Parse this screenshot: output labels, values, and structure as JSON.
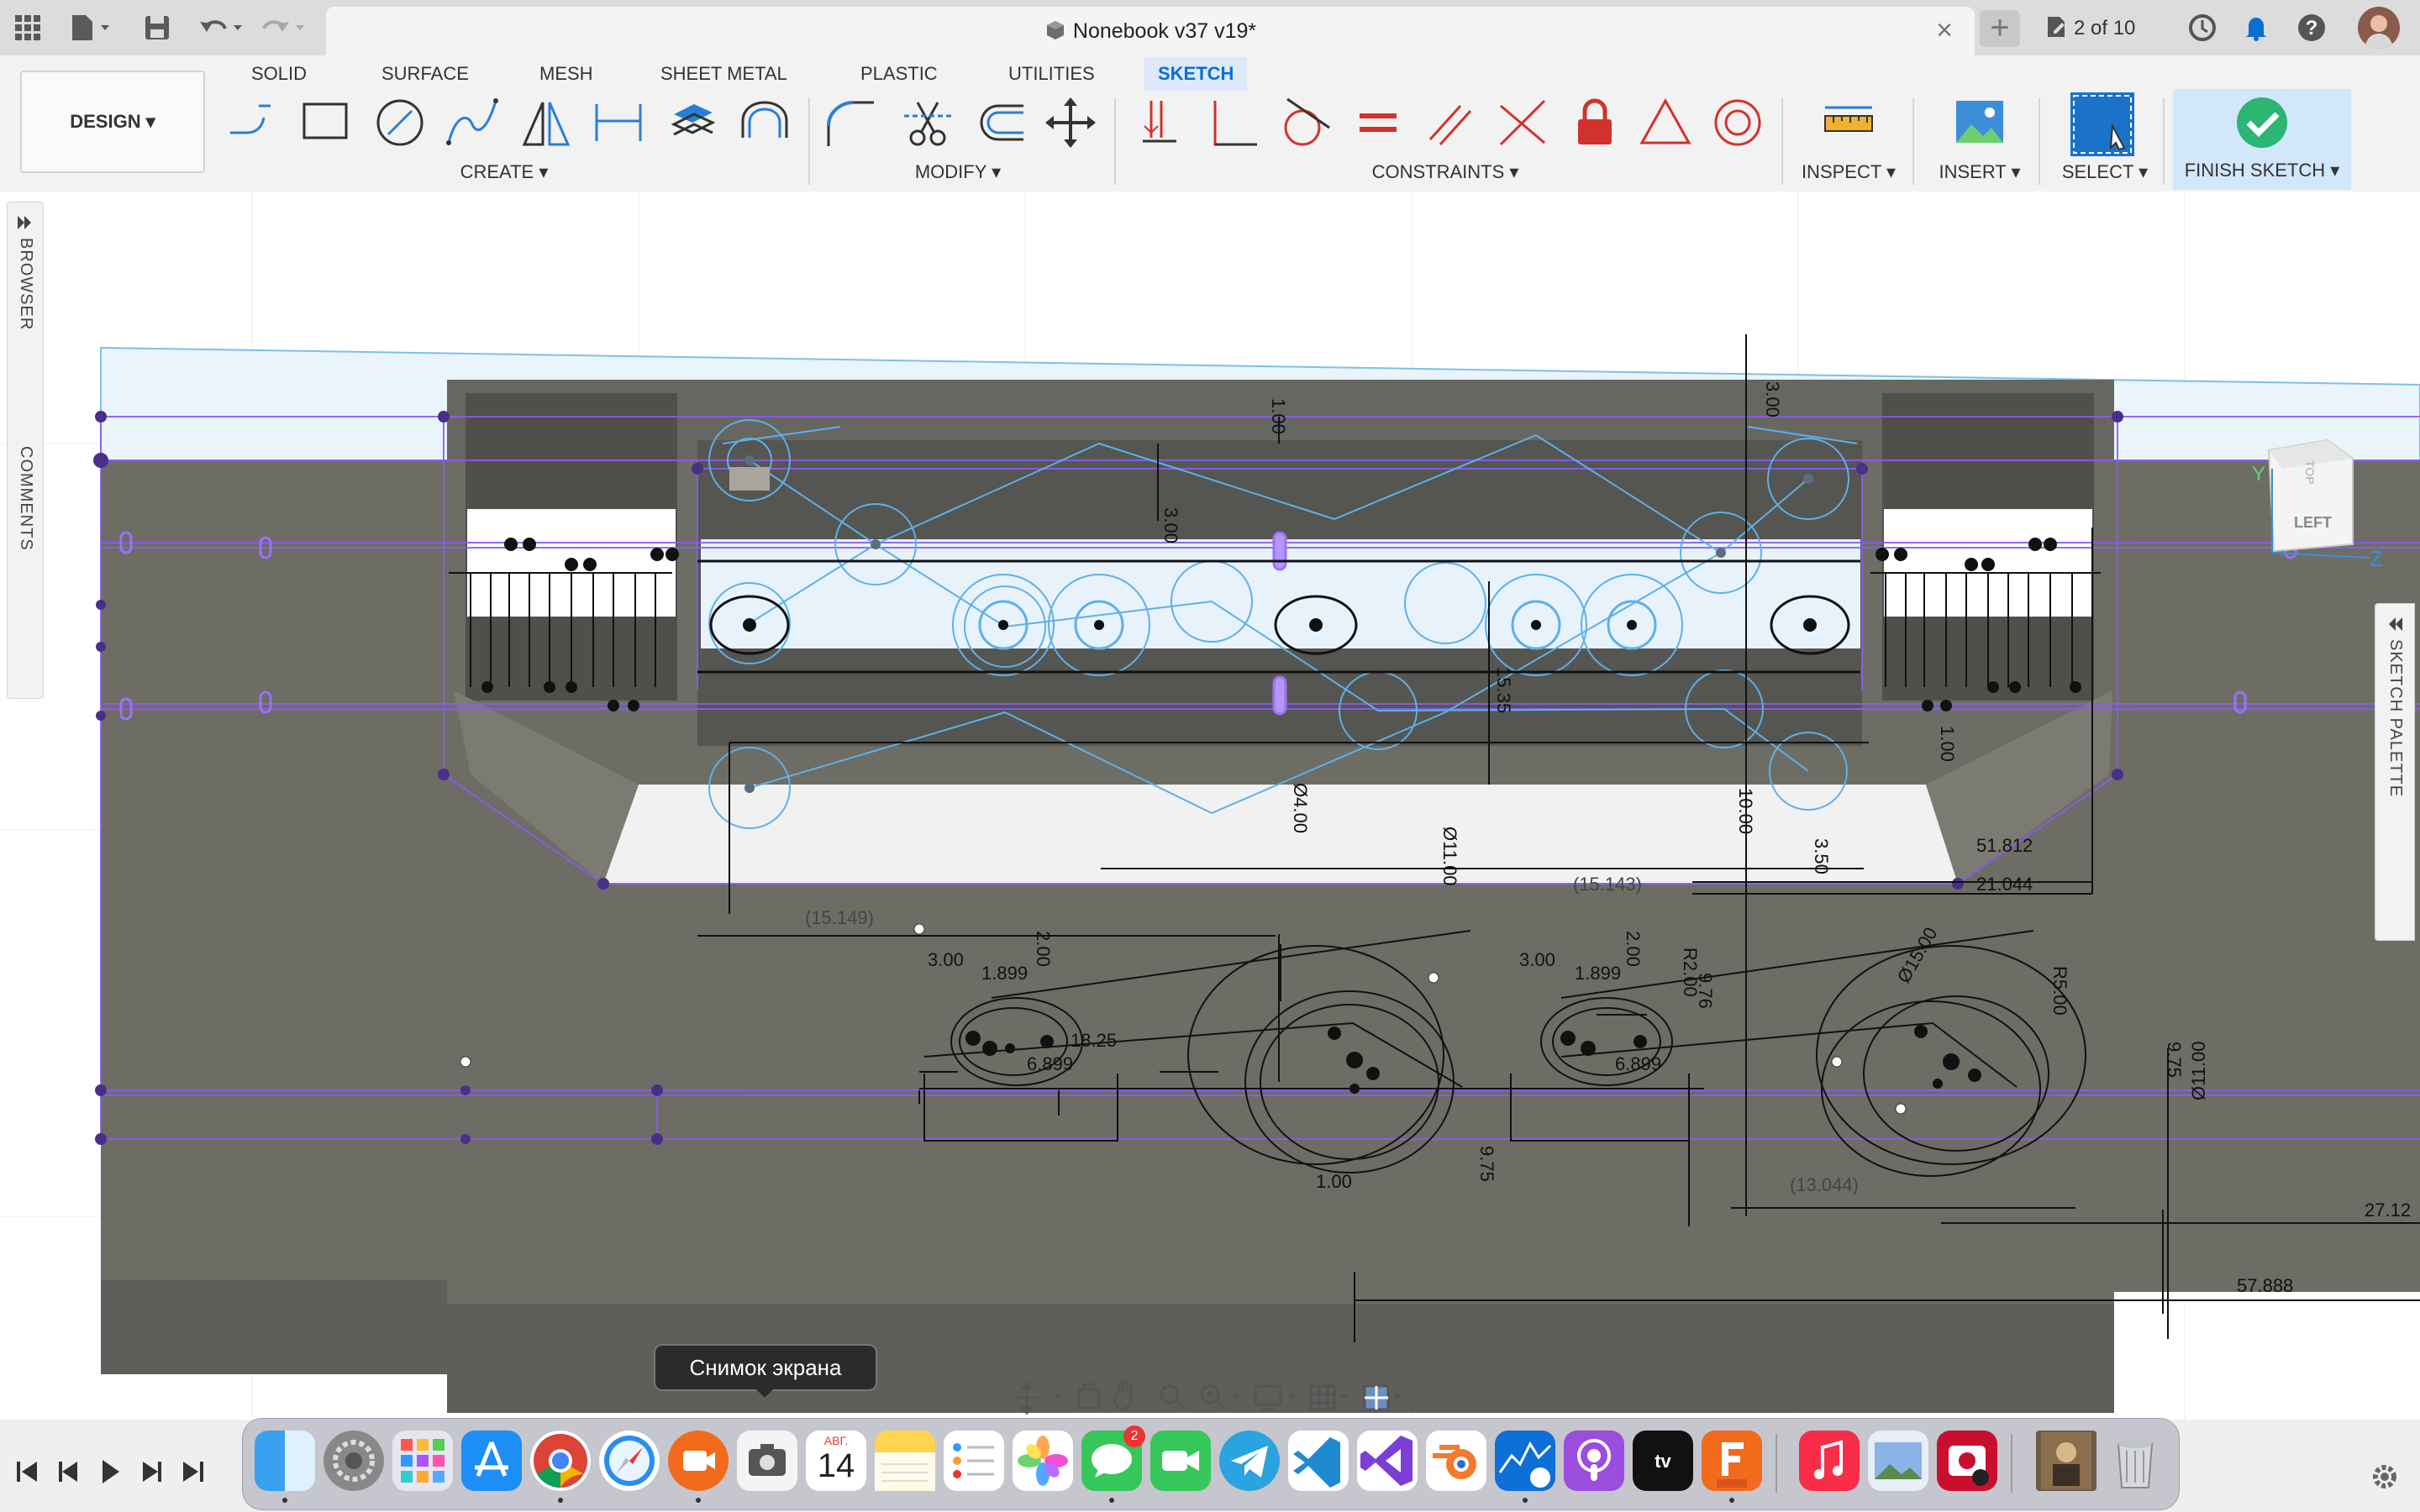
{
  "window": {
    "document_title": "Nonebook v37 v19*",
    "job_status": "2 of 10"
  },
  "ribbon": {
    "workspace_button": "DESIGN",
    "tabs": [
      {
        "label": "SOLID",
        "active": false
      },
      {
        "label": "SURFACE",
        "active": false
      },
      {
        "label": "MESH",
        "active": false
      },
      {
        "label": "SHEET METAL",
        "active": false
      },
      {
        "label": "PLASTIC",
        "active": false
      },
      {
        "label": "UTILITIES",
        "active": false
      },
      {
        "label": "SKETCH",
        "active": true
      }
    ],
    "groups": {
      "create": "CREATE",
      "modify": "MODIFY",
      "constraints": "CONSTRAINTS",
      "inspect": "INSPECT",
      "insert": "INSERT",
      "select": "SELECT",
      "finish": "FINISH SKETCH"
    },
    "create_tools": [
      "line-tool-icon",
      "rectangle-tool-icon",
      "circle-tool-icon",
      "spline-tool-icon",
      "mirror-tool-icon",
      "dimension-tool-icon",
      "project-tool-icon",
      "offset-tool-icon"
    ],
    "modify_tools": [
      "fillet-tool-icon",
      "trim-tool-icon",
      "offset-curve-icon",
      "move-tool-icon"
    ],
    "constraint_tools": [
      "coincident-icon",
      "perpendicular-icon",
      "tangent-icon",
      "equal-icon",
      "parallel-icon",
      "collinear-icon",
      "fix-icon",
      "midpoint-icon",
      "concentric-icon"
    ]
  },
  "side_panels": {
    "browser": "BROWSER",
    "comments": "COMMENTS",
    "sketch_palette": "SKETCH PALETTE"
  },
  "viewcube": {
    "face": "LEFT",
    "top_face": "TOP",
    "axis_y": "Y",
    "axis_z": "Z"
  },
  "dimensions": {
    "d_300_top": "3.00",
    "d_100_top": "1.00",
    "d_300_left": "3.00",
    "d_1535": "15.35",
    "d_100_right": "1.00",
    "d_1000": "10.00",
    "d_400": "Ø4.00",
    "d_350": "3.50",
    "d_1100_center": "Ø11.00",
    "d_15143": "(15.143)",
    "d_51812": "51.812",
    "d_21044": "21.044",
    "d_15149": "(15.149)",
    "d_1100_right": "Ø11.00",
    "d_300_a": "3.00",
    "d_200_a": "2.00",
    "d_1899_a": "1.899",
    "d_1825": "18.25",
    "d_6899_a": "6.899",
    "d_300_b": "3.00",
    "d_200_b": "2.00",
    "d_1899_b": "1.899",
    "d_6899_b": "6.899",
    "d_r200": "R2.00",
    "d_976": "9.76",
    "d_1500": "Ø15.00",
    "d_r500": "R5.00",
    "d_975_right": "9.75",
    "d_975_bottom": "9.75",
    "d_100_bottom": "1.00",
    "d_13044": "(13.044)",
    "d_2712": "27.12",
    "d_57888": "57.888"
  },
  "tooltip": "Снимок экрана",
  "dock": {
    "calendar_month": "АВГ.",
    "calendar_day": "14",
    "messages_badge": "2",
    "apps": [
      "finder-icon",
      "system-settings-icon",
      "launchpad-icon",
      "app-store-icon",
      "chrome-icon",
      "safari-icon",
      "screen-record-icon",
      "screenshot-icon",
      "calendar-icon",
      "notes-icon",
      "reminders-icon",
      "photos-icon",
      "messages-icon",
      "facetime-icon",
      "telegram-icon",
      "vscode-icon",
      "visual-studio-icon",
      "blender-icon",
      "intel-power-gadget-icon",
      "podcasts-icon",
      "apple-tv-icon",
      "fusion-360-icon",
      "music-icon",
      "preview-icon",
      "photo-booth-icon",
      "recent-doc-icon",
      "trash-icon"
    ]
  },
  "colors": {
    "accent": "#0a6fd1",
    "finish_check": "#2bb673",
    "sketch_purple": "#8a5cf0",
    "sketch_blue": "#5fb0e6",
    "body_gray": "#6d6d66"
  }
}
